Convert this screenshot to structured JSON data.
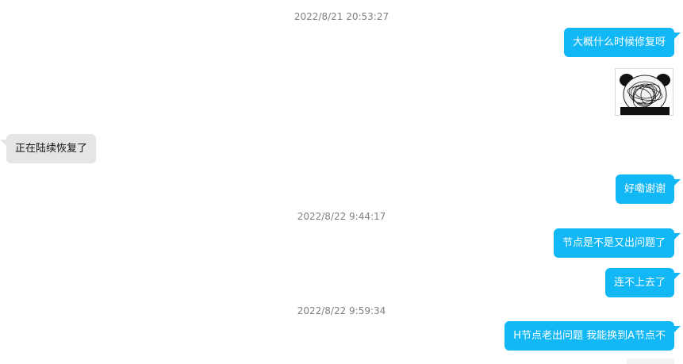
{
  "messages": {
    "ts1": "2022/8/21 20:53:27",
    "m1": "大概什么时候修复呀",
    "sticker_icon": "panda-scribble-sticker-icon",
    "m2": "正在陆续恢复了",
    "m3": "好嘞谢谢",
    "ts2": "2022/8/22 9:44:17",
    "m4": "节点是不是又出问题了",
    "m5": "连不上去了",
    "ts3": "2022/8/22 9:59:34",
    "m6": "H节点老出问题 我能换到A节点不"
  },
  "colors": {
    "outgoing": "#12b7f5",
    "incoming": "#e5e5e5",
    "timestamp": "#808080"
  }
}
